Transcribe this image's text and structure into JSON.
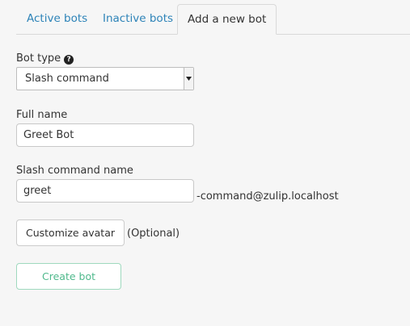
{
  "tabs": [
    {
      "label": "Active bots",
      "active": false
    },
    {
      "label": "Inactive bots",
      "active": false
    },
    {
      "label": "Add a new bot",
      "active": true
    }
  ],
  "form": {
    "bot_type": {
      "label": "Bot type",
      "help_icon": "question-circle-icon",
      "selected": "Slash command"
    },
    "full_name": {
      "label": "Full name",
      "value": "Greet Bot"
    },
    "slash_command": {
      "label": "Slash command name",
      "value": "greet",
      "suffix": "-command@zulip.localhost"
    },
    "avatar": {
      "button_label": "Customize avatar",
      "optional_label": "(Optional)"
    },
    "submit": {
      "label": "Create bot"
    }
  },
  "colors": {
    "link": "#2d83b8",
    "create_button": "#4fb98c",
    "background": "#f6f6f6"
  }
}
